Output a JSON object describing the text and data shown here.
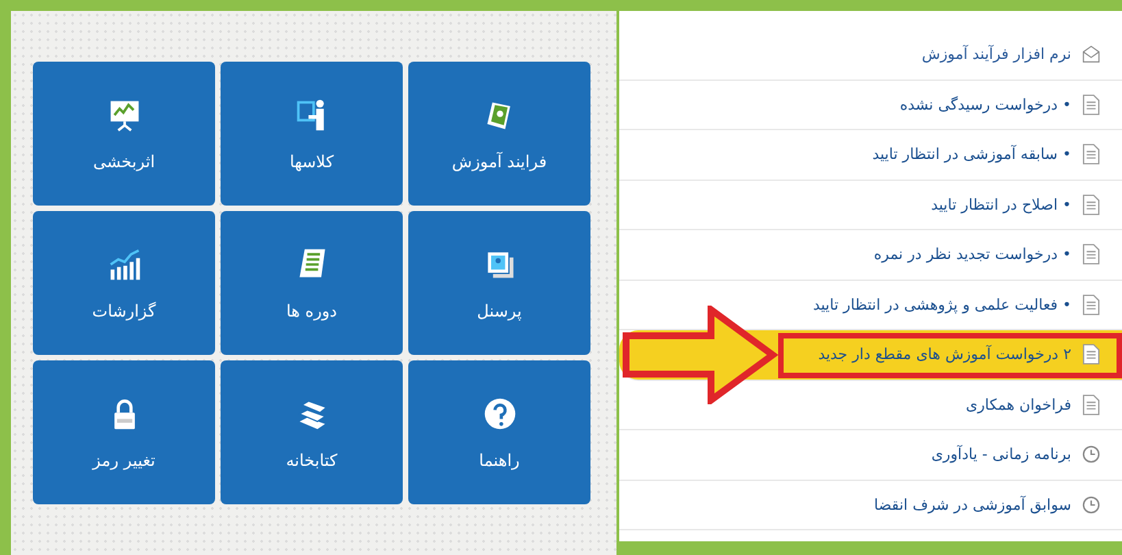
{
  "tiles": [
    {
      "label": "فرایند آموزش",
      "kind": "book"
    },
    {
      "label": "کلاسها",
      "kind": "teacher"
    },
    {
      "label": "اثربخشی",
      "kind": "presentation"
    },
    {
      "label": "پرسنل",
      "kind": "photos"
    },
    {
      "label": "دوره ها",
      "kind": "scroll"
    },
    {
      "label": "گزارشات",
      "kind": "chart"
    },
    {
      "label": "راهنما",
      "kind": "help"
    },
    {
      "label": "کتابخانه",
      "kind": "books"
    },
    {
      "label": "تغییر رمز",
      "kind": "lock"
    }
  ],
  "menu": [
    {
      "label": "نرم افزار فرآیند آموزش",
      "kind": "header",
      "selected": false
    },
    {
      "label": "• درخواست رسیدگی نشده",
      "kind": "document",
      "selected": false
    },
    {
      "label": "• سابقه آموزشی در انتظار تایید",
      "kind": "document",
      "selected": false
    },
    {
      "label": "• اصلاح در انتظار تایید",
      "kind": "document",
      "selected": false
    },
    {
      "label": "• درخواست تجدید نظر در نمره",
      "kind": "document",
      "selected": false
    },
    {
      "label": "• فعالیت علمی و پژوهشی در انتظار تایید",
      "kind": "document",
      "selected": false
    },
    {
      "label": "۲ درخواست آموزش های مقطع دار جدید",
      "kind": "document",
      "selected": true
    },
    {
      "label": "فراخوان همکاری",
      "kind": "document",
      "selected": false
    },
    {
      "label": "برنامه زمانی - یادآوری",
      "kind": "schedule",
      "selected": false
    },
    {
      "label": "سوابق آموزشی در شرف انقضا",
      "kind": "schedule",
      "selected": false
    }
  ]
}
